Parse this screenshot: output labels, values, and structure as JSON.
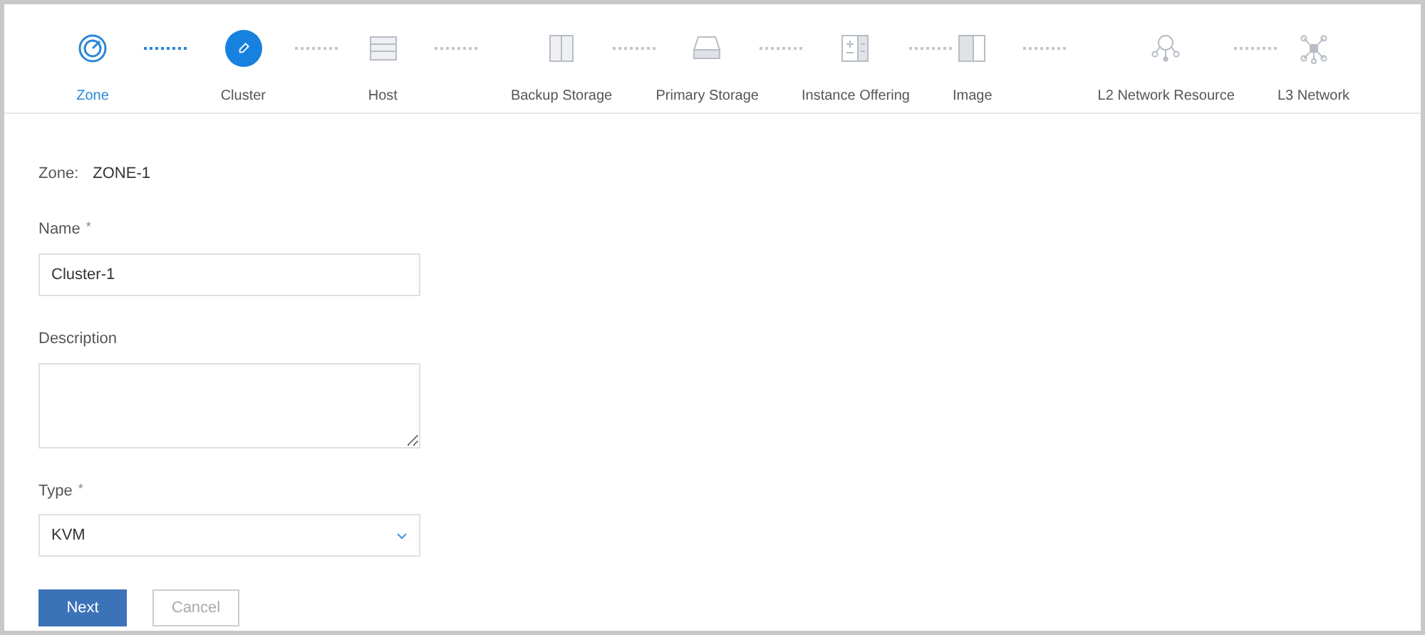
{
  "steps": [
    {
      "label": "Zone",
      "completed": true,
      "selected": false
    },
    {
      "label": "Cluster",
      "completed": false,
      "selected": true
    },
    {
      "label": "Host",
      "completed": false,
      "selected": false
    },
    {
      "label": "Backup Storage",
      "completed": false,
      "selected": false
    },
    {
      "label": "Primary Storage",
      "completed": false,
      "selected": false
    },
    {
      "label": "Instance Offering",
      "completed": false,
      "selected": false
    },
    {
      "label": "Image",
      "completed": false,
      "selected": false
    },
    {
      "label": "L2 Network Resource",
      "completed": false,
      "selected": false
    },
    {
      "label": "L3 Network",
      "completed": false,
      "selected": false
    }
  ],
  "zone": {
    "label": "Zone:",
    "value": "ZONE-1"
  },
  "fields": [
    {
      "kind": "text",
      "label": "Name",
      "required_mark": "*",
      "value": "Cluster-1"
    },
    {
      "kind": "textarea",
      "label": "Description"
    },
    {
      "kind": "select",
      "label": "Type",
      "required_mark": "*",
      "value": "KVM"
    }
  ],
  "buttons": [
    {
      "label": "Next",
      "kind": "primary"
    },
    {
      "label": "Cancel",
      "kind": "secondary"
    }
  ]
}
